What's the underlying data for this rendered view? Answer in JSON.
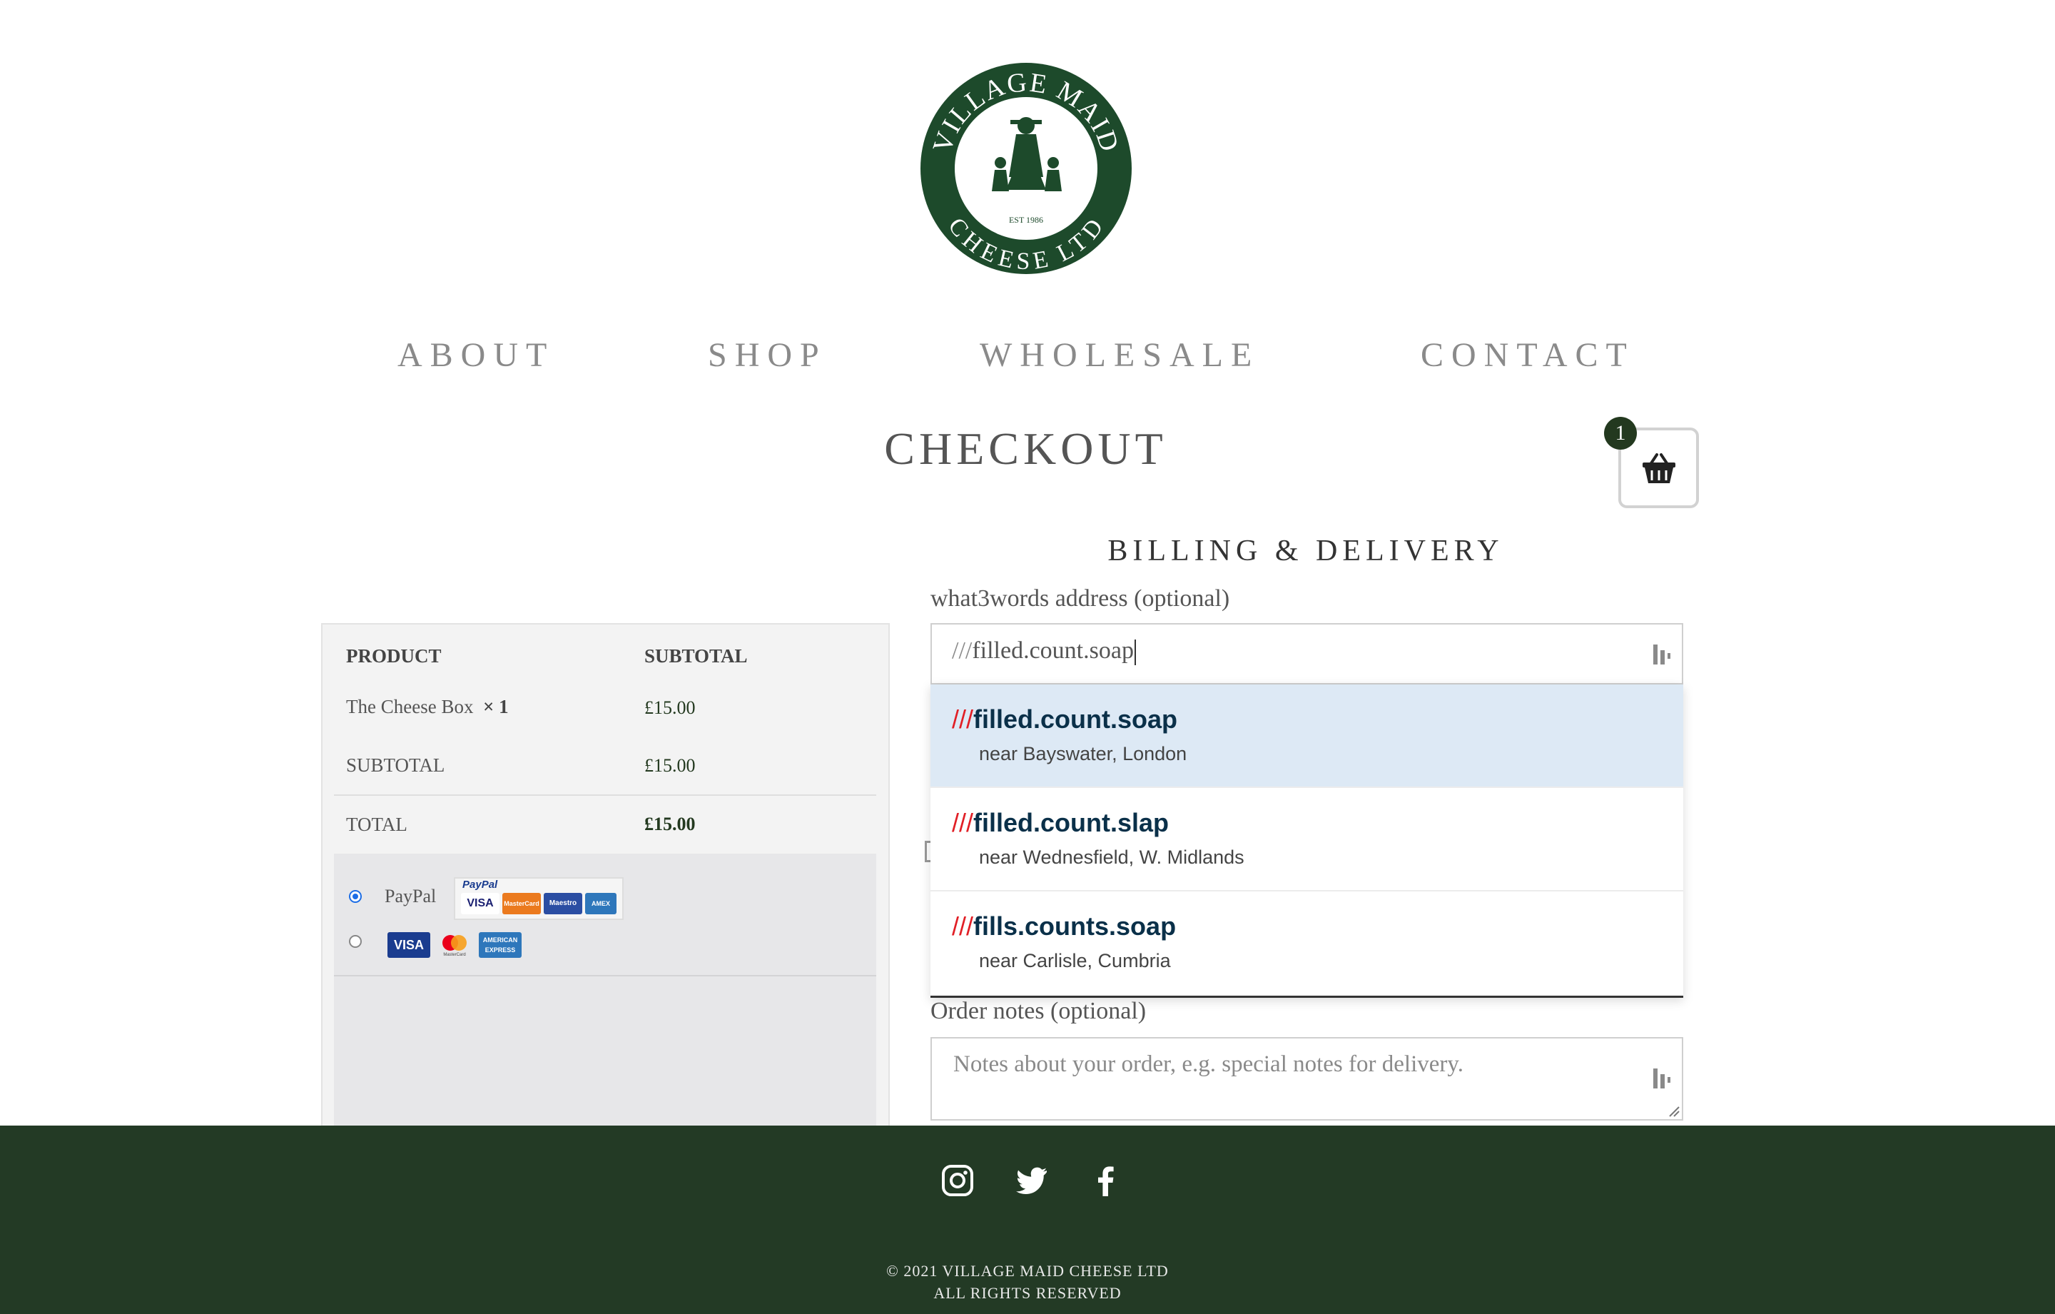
{
  "brand": {
    "name": "VILLAGE MAID CHEESE LTD",
    "logo_top_text": "VILLAGE MAID",
    "logo_bottom_text": "CHEESE LTD",
    "logo_est": "EST 1986",
    "color_primary": "#23391f"
  },
  "nav": {
    "items": [
      "ABOUT",
      "SHOP",
      "WHOLESALE",
      "CONTACT"
    ]
  },
  "page": {
    "title": "CHECKOUT"
  },
  "cart": {
    "count": "1",
    "icon": "basket-icon"
  },
  "order": {
    "headers": {
      "product": "PRODUCT",
      "subtotal": "SUBTOTAL"
    },
    "item": {
      "name": "The Cheese Box",
      "qty": "× 1",
      "price": "£15.00"
    },
    "subtotal": {
      "label": "SUBTOTAL",
      "value": "£15.00"
    },
    "total": {
      "label": "TOTAL",
      "value": "£15.00"
    },
    "payment": {
      "paypal_label": "PayPal",
      "paypal_brand": "PayPal",
      "paypal_cards": [
        "VISA",
        "MasterCard",
        "Maestro",
        "AMEX"
      ],
      "card_brands": [
        "VISA",
        "MasterCard",
        "AMERICAN EXPRESS"
      ],
      "selected": "paypal"
    }
  },
  "billing": {
    "title": "BILLING & DELIVERY",
    "w3w": {
      "label": "what3words address (optional)",
      "prefix": "///",
      "value": "filled.count.soap",
      "suggestions": [
        {
          "words": "filled.count.soap",
          "near": "near Bayswater, London",
          "active": true
        },
        {
          "words": "filled.count.slap",
          "near": "near Wednesfield, W. Midlands",
          "active": false
        },
        {
          "words": "fills.counts.soap",
          "near": "near Carlisle, Cumbria",
          "active": false
        }
      ]
    },
    "notes": {
      "label": "Order notes (optional)",
      "placeholder": "Notes about your order, e.g. special notes for delivery."
    }
  },
  "footer": {
    "social": [
      "instagram-icon",
      "twitter-icon",
      "facebook-icon"
    ],
    "copyright": "© 2021 VILLAGE MAID CHEESE LTD",
    "rights": "ALL RIGHTS RESERVED"
  }
}
